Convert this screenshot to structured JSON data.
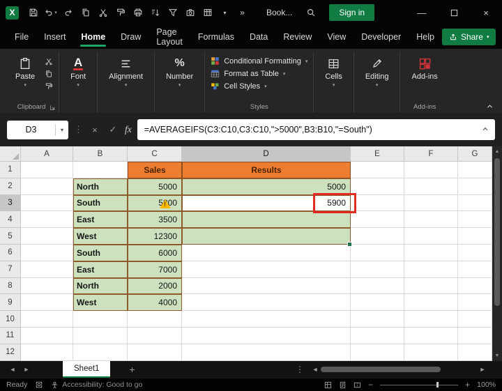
{
  "titlebar": {
    "workbook_name": "Book...",
    "sign_in_label": "Sign in",
    "more_commands_glyph": "»"
  },
  "menu": {
    "tabs": [
      "File",
      "Insert",
      "Home",
      "Draw",
      "Page Layout",
      "Formulas",
      "Data",
      "Review",
      "View",
      "Developer",
      "Help"
    ],
    "active_tab": "Home",
    "share_label": "Share"
  },
  "ribbon": {
    "paste_label": "Paste",
    "clipboard_group_label": "Clipboard",
    "font_label": "Font",
    "alignment_label": "Alignment",
    "number_label": "Number",
    "styles": {
      "conditional_formatting": "Conditional Formatting",
      "format_as_table": "Format as Table",
      "cell_styles": "Cell Styles",
      "group_label": "Styles"
    },
    "cells_label": "Cells",
    "editing_label": "Editing",
    "addins_label": "Add-ins",
    "addins_group_label": "Add-ins"
  },
  "formula_bar": {
    "name_box": "D3",
    "fx_label": "fx",
    "formula": "=AVERAGEIFS(C3:C10,C3:C10,\">5000\",B3:B10,\"=South\")"
  },
  "sheet": {
    "columns": [
      "A",
      "B",
      "C",
      "D",
      "E",
      "F",
      "G"
    ],
    "selected_column": "D",
    "selected_row": 3,
    "active_cell": "D3",
    "rows": [
      {
        "n": 1,
        "cells": [
          {
            "col": "C",
            "v": "Sales",
            "cls": "c-orange"
          },
          {
            "col": "D",
            "v": "Results",
            "cls": "c-orange"
          }
        ]
      },
      {
        "n": 2,
        "cells": [
          {
            "col": "B",
            "v": "North",
            "cls": "c-green c-bold"
          },
          {
            "col": "C",
            "v": "5000",
            "cls": "c-green c-num"
          },
          {
            "col": "D",
            "v": "5000",
            "cls": "c-green c-num"
          }
        ]
      },
      {
        "n": 3,
        "cells": [
          {
            "col": "B",
            "v": "South",
            "cls": "c-green c-bold"
          },
          {
            "col": "C",
            "v": "5800",
            "cls": "c-green c-num",
            "warn": true
          },
          {
            "col": "D",
            "v": "5900",
            "cls": "c-green c-num c-active"
          }
        ]
      },
      {
        "n": 4,
        "cells": [
          {
            "col": "B",
            "v": "East",
            "cls": "c-green c-bold"
          },
          {
            "col": "C",
            "v": "3500",
            "cls": "c-green c-num"
          },
          {
            "col": "D",
            "v": "",
            "cls": "c-green"
          }
        ]
      },
      {
        "n": 5,
        "cells": [
          {
            "col": "B",
            "v": "West",
            "cls": "c-green c-bold"
          },
          {
            "col": "C",
            "v": "12300",
            "cls": "c-green c-num"
          },
          {
            "col": "D",
            "v": "",
            "cls": "c-green"
          }
        ]
      },
      {
        "n": 6,
        "cells": [
          {
            "col": "B",
            "v": "South",
            "cls": "c-green c-bold"
          },
          {
            "col": "C",
            "v": "6000",
            "cls": "c-green c-num"
          }
        ]
      },
      {
        "n": 7,
        "cells": [
          {
            "col": "B",
            "v": "East",
            "cls": "c-green c-bold"
          },
          {
            "col": "C",
            "v": "7000",
            "cls": "c-green c-num"
          }
        ]
      },
      {
        "n": 8,
        "cells": [
          {
            "col": "B",
            "v": "North",
            "cls": "c-green c-bold"
          },
          {
            "col": "C",
            "v": "2000",
            "cls": "c-green c-num"
          }
        ]
      },
      {
        "n": 9,
        "cells": [
          {
            "col": "B",
            "v": "West",
            "cls": "c-green c-bold"
          },
          {
            "col": "C",
            "v": "4000",
            "cls": "c-green c-num"
          }
        ]
      },
      {
        "n": 10,
        "cells": []
      },
      {
        "n": 11,
        "cells": []
      },
      {
        "n": 12,
        "cells": []
      }
    ]
  },
  "tabs_bar": {
    "sheet_name": "Sheet1"
  },
  "status_bar": {
    "ready": "Ready",
    "accessibility": "Accessibility: Good to go",
    "zoom": "100%"
  },
  "colors": {
    "accent_green": "#107C41",
    "header_fill": "#ED7D31",
    "table_fill": "#CEE1BE",
    "annotation_red": "#E02B20",
    "warning_yellow": "#FFB900"
  }
}
